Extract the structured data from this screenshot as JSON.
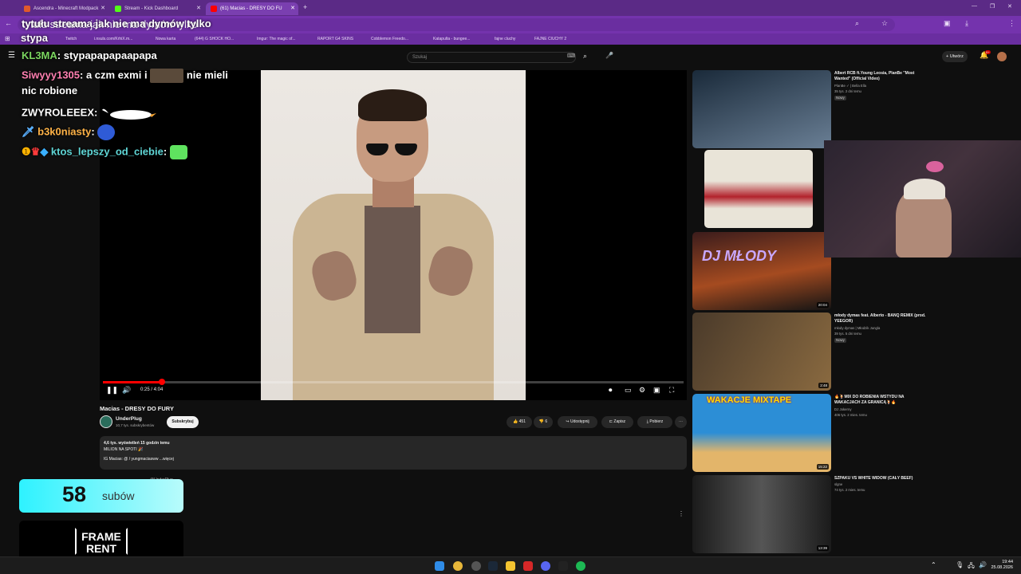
{
  "tabs": [
    {
      "label": "Ascendra - Minecraft Modpack",
      "color": "#e05a2c"
    },
    {
      "label": "Stream - Kick Dashboard",
      "color": "#53fc18"
    },
    {
      "label": "(61) Macias - DRESY DO FU",
      "color": "#ff0000",
      "active": true
    }
  ],
  "browser": {
    "address": "tytułu streama jak nie ma dymów tylko",
    "bookmarks": [
      "Twitch",
      "i.nsuls.com/KrhiX.m...",
      "Nowa karta",
      "(644) G SHOCK HO...",
      "Imgur: The magic of...",
      "RAPORT G4 SKINS",
      "Cobblemon Freedo...",
      "Katapulta - bungee...",
      "fajne cluchy",
      "FAJNE CIUCHY 2"
    ]
  },
  "youtube": {
    "search_placeholder": "Szukaj",
    "create_label": "Utwórz",
    "notif_count": "9+"
  },
  "overlay": {
    "title": "tytułu streama jak nie ma dymów tylko",
    "streamer": "stypa",
    "chat": [
      {
        "nick": "KL3MA",
        "text": ": stypapapapaapapa",
        "color": "#7bd65f"
      },
      {
        "nick": "Siwyyy1305",
        "text": ": a czm exmi i",
        "tail": "nie mieli",
        "color": "#ff7fb0"
      },
      {
        "nick": "",
        "text": "nic robione",
        "color": "#ffffff"
      },
      {
        "nick": "ZWYROLEEEX",
        "text": ":",
        "color": "#ffffff"
      },
      {
        "nick": "b3k0niasty",
        "text": ":",
        "color": "#ffb347"
      },
      {
        "nick": "ktos_lepszy_od_ciebie",
        "text": ":",
        "color": "#5fd6d6"
      }
    ]
  },
  "video": {
    "title": "Macias - DRESY DO FURY",
    "time": "0:25 / 4:04",
    "progress": 0.102,
    "channel": "UnderPlug",
    "subscribers": "10,7 tys. subskrybentów",
    "subscribe_label": "Subskrybuj",
    "likes": "451",
    "dislikes": "6",
    "share_label": "Udostępnij",
    "save_label": "Zapisz",
    "download_label": "Pobierz",
    "desc_line1": "4,6 tys. wyświetleń  15 godzin temu",
    "desc_line2": "MILION NA SPOTI 🎉",
    "desc_line3": "IG Macias: @ / yungmaciasww   ...więcej",
    "comment_author": "@UnderPlug"
  },
  "recommendations": [
    {
      "title": "Albert RCB ft.Young Leosia, PlanBe \"Most Wanted\" (Official Video)",
      "channel": "PlanBe ✓ | Bella Ella",
      "meta": "35 tys.  2 dni temu",
      "badge": "Nowy",
      "duration": "",
      "palette": [
        "#1a2a3a",
        "#6a7f95"
      ]
    },
    {
      "title": "",
      "channel": "",
      "meta": "",
      "badge": "",
      "duration": "",
      "palette": [
        "#e9e4d8",
        "#b2222c"
      ]
    },
    {
      "title": "",
      "channel": "",
      "meta": "",
      "badge": "",
      "duration": "20:04",
      "palette": [
        "#3b1c1c",
        "#a54b20"
      ]
    },
    {
      "title": "młody dymas feat. Alberto - BANQ REMIX (prod. YEEGOR)",
      "channel": "młody dymas | Młodzik Jungla",
      "meta": "39 tys.  5 dni temu",
      "badge": "Nowy",
      "duration": "2:48",
      "palette": [
        "#4a3a2a",
        "#8a6a40"
      ]
    },
    {
      "title": "🔥🍹MIX DO ROBIENIA WSTYDU NA WAKACJACH ZA GRANICĄ🍹🔥",
      "channel": "DJ Jokerny",
      "meta": "406 tys.  2 mies. temu",
      "badge": "",
      "duration": "15:22",
      "palette": [
        "#2c8ed6",
        "#e3b56a"
      ]
    },
    {
      "title": "SZPAKU VS WHITE WIDOW (CAŁY BEEF)",
      "channel": "slgne",
      "meta": "74 tys.  2 mies. temu",
      "badge": "",
      "duration": "13:39",
      "palette": [
        "#1b1b1b",
        "#555555"
      ]
    }
  ],
  "widgets": {
    "sub_count": "58",
    "sub_label": "subów",
    "framerent_line1": "FRAME",
    "framerent_line2": "RENT"
  },
  "thumb_texts": {
    "dj": "DJ MŁODY",
    "wakacje": "WAKACJE MIXTAPE"
  },
  "system": {
    "time": "19:44",
    "date": "25.08.2026"
  }
}
